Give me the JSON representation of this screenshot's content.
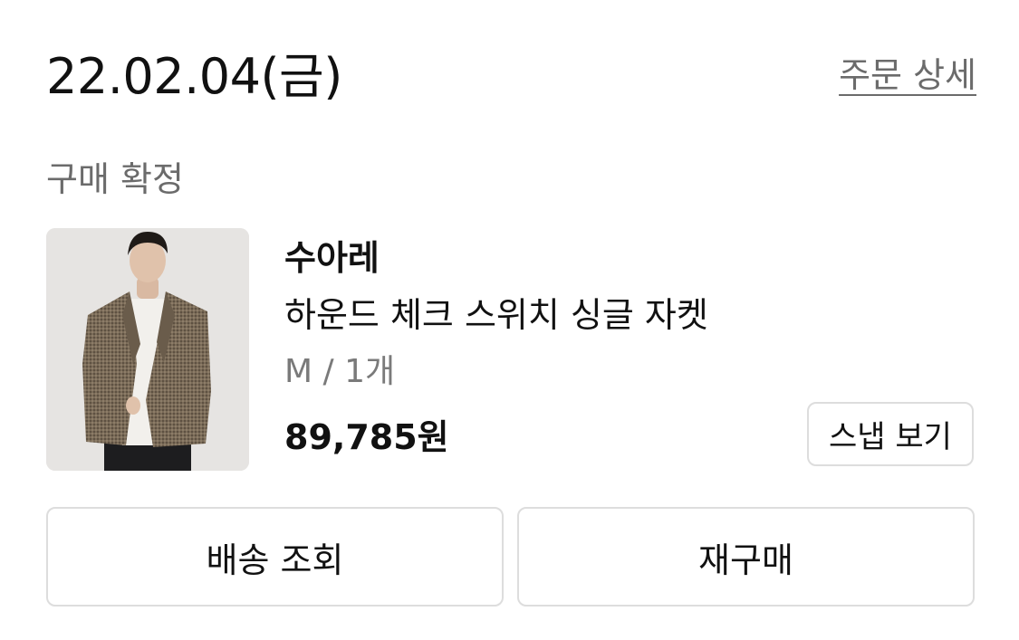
{
  "order": {
    "date": "22.02.04(금)",
    "detail_link": "주문 상세",
    "status": "구매 확정"
  },
  "product": {
    "brand": "수아레",
    "name": "하운드 체크 스위치 싱글 자켓",
    "option": "M / 1개",
    "price": "89,785원",
    "image_alt": "하운드 체크 스위치 싱글 자켓"
  },
  "buttons": {
    "snap": "스냅 보기",
    "tracking": "배송 조회",
    "rebuy": "재구매"
  },
  "colors": {
    "text_primary": "#111111",
    "text_secondary": "#6b6b6b",
    "border": "#dddddd",
    "thumbnail_bg": "#e6e4e2"
  }
}
